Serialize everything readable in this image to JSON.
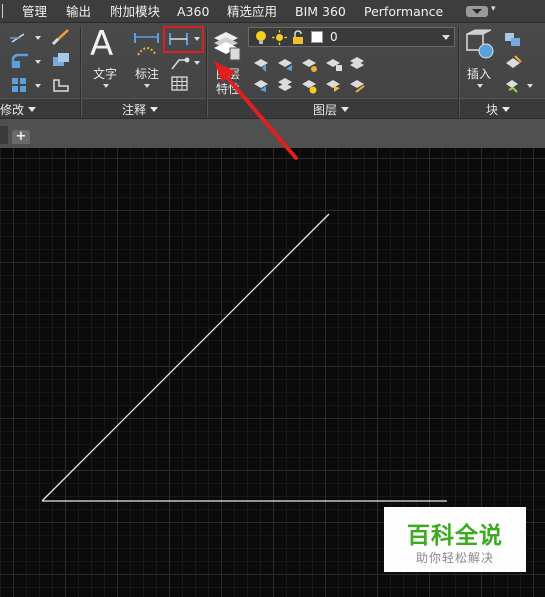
{
  "menu": {
    "items": [
      "管理",
      "输出",
      "附加模块",
      "A360",
      "精选应用",
      "BIM 360",
      "Performance"
    ]
  },
  "ribbon": {
    "modify_panel_title": "修改",
    "annotation": {
      "text_label": "文字",
      "dimension_label": "标注",
      "panel_title": "注释",
      "text_glyph": "A"
    },
    "layers": {
      "properties_label_line1": "图层",
      "properties_label_line2": "特性",
      "current_layer": "0",
      "panel_title": "图层"
    },
    "block": {
      "insert_label": "插入",
      "panel_title": "块"
    }
  },
  "tabs": {
    "new_tab_glyph": "+"
  },
  "watermark": {
    "title": "百科全说",
    "subtitle": "助你轻松解决"
  },
  "colors": {
    "highlight": "#e02020",
    "watermark_green": "#3cab1e",
    "drawing_line": "#e8e8e8"
  }
}
